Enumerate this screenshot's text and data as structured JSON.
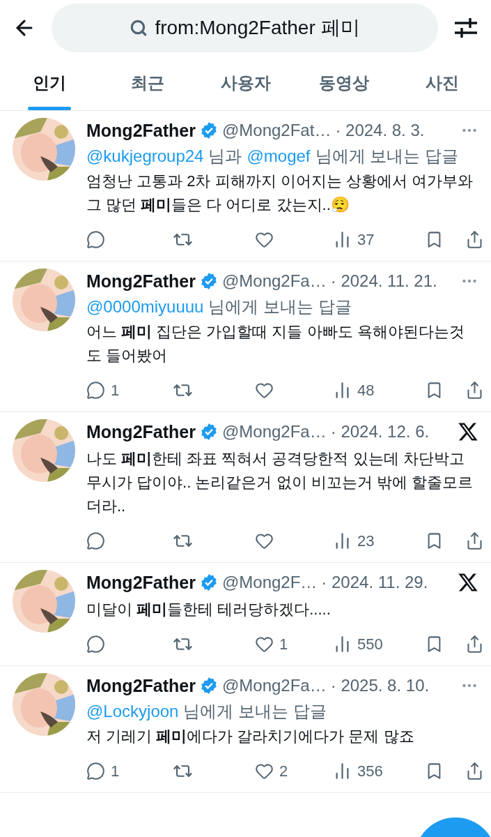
{
  "search": {
    "value": "from:Mong2Father 페미"
  },
  "tabs": [
    {
      "label": "인기",
      "selected": true
    },
    {
      "label": "최근",
      "selected": false
    },
    {
      "label": "사용자",
      "selected": false
    },
    {
      "label": "동영상",
      "selected": false
    },
    {
      "label": "사진",
      "selected": false
    }
  ],
  "tweets": [
    {
      "name": "Mong2Father",
      "handle": "@Mong2Fat…",
      "date": "· 2024. 8. 3.",
      "kind": "more",
      "reply_to": [
        {
          "kind": "mention",
          "text": "@kukjegroup24"
        },
        {
          "kind": "plain",
          "text": "님과"
        },
        {
          "kind": "mention",
          "text": "@mogef"
        },
        {
          "kind": "plain",
          "text": "님에게 보내는 답글"
        }
      ],
      "body": "엄청난 고통과 2차 피해까지 이어지는 상황에서 여가부와 그 많던 **페미**들은 다 어디로 갔는지..😮‍💨",
      "stats": {
        "views": "37"
      }
    },
    {
      "name": "Mong2Father",
      "handle": "@Mong2Fa…",
      "date": "· 2024. 11. 21.",
      "kind": "more",
      "reply_to": [
        {
          "kind": "mention",
          "text": "@0000miyuuuu"
        },
        {
          "kind": "plain",
          "text": "님에게 보내는 답글"
        }
      ],
      "body": "어느 **페미** 집단은 가입할때 지들 아빠도 욕해야된다는것도 들어봤어",
      "stats": {
        "replies": "1",
        "views": "48"
      }
    },
    {
      "name": "Mong2Father",
      "handle": "@Mong2Fa…",
      "date": "· 2024. 12. 6.",
      "kind": "x-logo",
      "body": "나도 **페미**한테 좌표 찍혀서 공격당한적 있는데 차단박고 무시가 답이야.. 논리같은거 없이 비꼬는거 밖에 할줄모르더라..",
      "stats": {
        "views": "23"
      }
    },
    {
      "name": "Mong2Father",
      "handle": "@Mong2F…",
      "date": "· 2024. 11. 29.",
      "kind": "x-logo",
      "body": "미달이 **페미**들한테 테러당하겠다.....",
      "stats": {
        "likes": "1",
        "views": "550"
      }
    },
    {
      "name": "Mong2Father",
      "handle": "@Mong2Fa…",
      "date": "· 2025. 8. 10.",
      "kind": "more",
      "reply_to": [
        {
          "kind": "mention",
          "text": "@Lockyjoon"
        },
        {
          "kind": "plain",
          "text": "님에게 보내는 답글"
        }
      ],
      "body": "저 기레기 **페미**에다가 갈라치기에다가 문제 많죠",
      "stats": {
        "replies": "1",
        "likes": "2",
        "views": "356"
      }
    }
  ]
}
